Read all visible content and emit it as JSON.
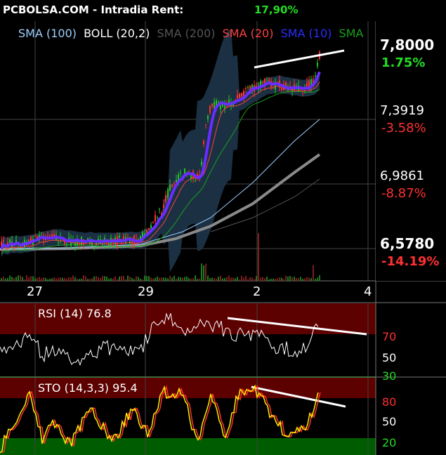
{
  "header": {
    "title": "PCBOLSA.COM - Intradia  Rent:",
    "rent": "17,90%"
  },
  "indicators": [
    {
      "label": "SMA (100)",
      "color": "#9ecfff"
    },
    {
      "label": "BOLL (20,2)",
      "color": "#ffffff"
    },
    {
      "label": "SMA (200)",
      "color": "#555555"
    },
    {
      "label": "SMA (20)",
      "color": "#ff4040"
    },
    {
      "label": "SMA (10)",
      "color": "#2d2dff"
    },
    {
      "label": "SMA",
      "color": "#1aa01a"
    }
  ],
  "price_axis": [
    {
      "price": "7,8000",
      "pct": "1.75%",
      "pct_color": "#22dd22",
      "bold": true
    },
    {
      "price": "7,3919",
      "pct": "-3.58%",
      "pct_color": "#ff3030",
      "bold": false
    },
    {
      "price": "6,9861",
      "pct": "-8.87%",
      "pct_color": "#ff3030",
      "bold": false
    },
    {
      "price": "6,5780",
      "pct": "-14.19%",
      "pct_color": "#ff3030",
      "bold": true
    }
  ],
  "x_axis": [
    "27",
    "29",
    "2",
    "4"
  ],
  "rsi": {
    "label": "RSI (14) 76.8",
    "levels": [
      "70",
      "50",
      "30"
    ]
  },
  "sto": {
    "label": "STO (14,3,3) 95.4",
    "levels": [
      "80",
      "50",
      "20"
    ]
  },
  "colors": {
    "up": "#22c222",
    "down": "#ff3030",
    "boll_fill": "#1c3347",
    "rsi_band": "#5c0000",
    "sto_upper": "#5c0000",
    "sto_lower": "#005c00",
    "grid": "#444444"
  },
  "chart_data": {
    "type": "candlestick",
    "price_levels": [
      7.8,
      7.3919,
      6.9861,
      6.578
    ],
    "approx_close_path": [
      6.59,
      6.62,
      6.6,
      6.63,
      6.62,
      6.6,
      6.61,
      6.6,
      6.62,
      6.7,
      6.9,
      7.05,
      7.0,
      7.4,
      7.45,
      7.5,
      7.6,
      7.65,
      7.62,
      7.66,
      7.8
    ],
    "rsi_last": 76.8,
    "sto_last": 95.4
  }
}
